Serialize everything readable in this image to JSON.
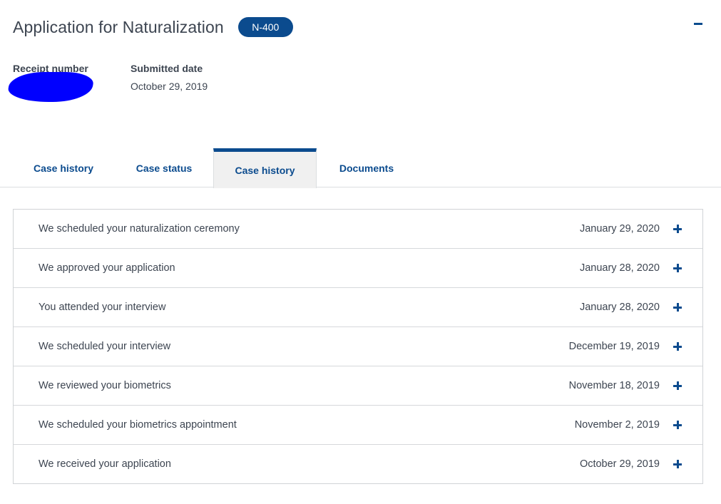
{
  "header": {
    "title": "Application for Naturalization",
    "form_badge": "N-400",
    "collapse_icon": "minus-icon"
  },
  "receipt": {
    "label": "Receipt number"
  },
  "submitted": {
    "label": "Submitted date",
    "value": "October 29, 2019"
  },
  "tabs": [
    {
      "label": "Case history",
      "active": false
    },
    {
      "label": "Case status",
      "active": false
    },
    {
      "label": "Case history",
      "active": true
    },
    {
      "label": "Documents",
      "active": false
    }
  ],
  "history": [
    {
      "title": "We scheduled your naturalization ceremony",
      "date": "January 29, 2020"
    },
    {
      "title": "We approved your application",
      "date": "January 28, 2020"
    },
    {
      "title": "You attended your interview",
      "date": "January 28, 2020"
    },
    {
      "title": "We scheduled your interview",
      "date": "December 19, 2019"
    },
    {
      "title": "We reviewed your biometrics",
      "date": "November 18, 2019"
    },
    {
      "title": "We scheduled your biometrics appointment",
      "date": "November 2, 2019"
    },
    {
      "title": "We received your application",
      "date": "October 29, 2019"
    }
  ],
  "colors": {
    "accent": "#0b4b8e",
    "text": "#3d4551",
    "redaction": "#0000ff"
  }
}
